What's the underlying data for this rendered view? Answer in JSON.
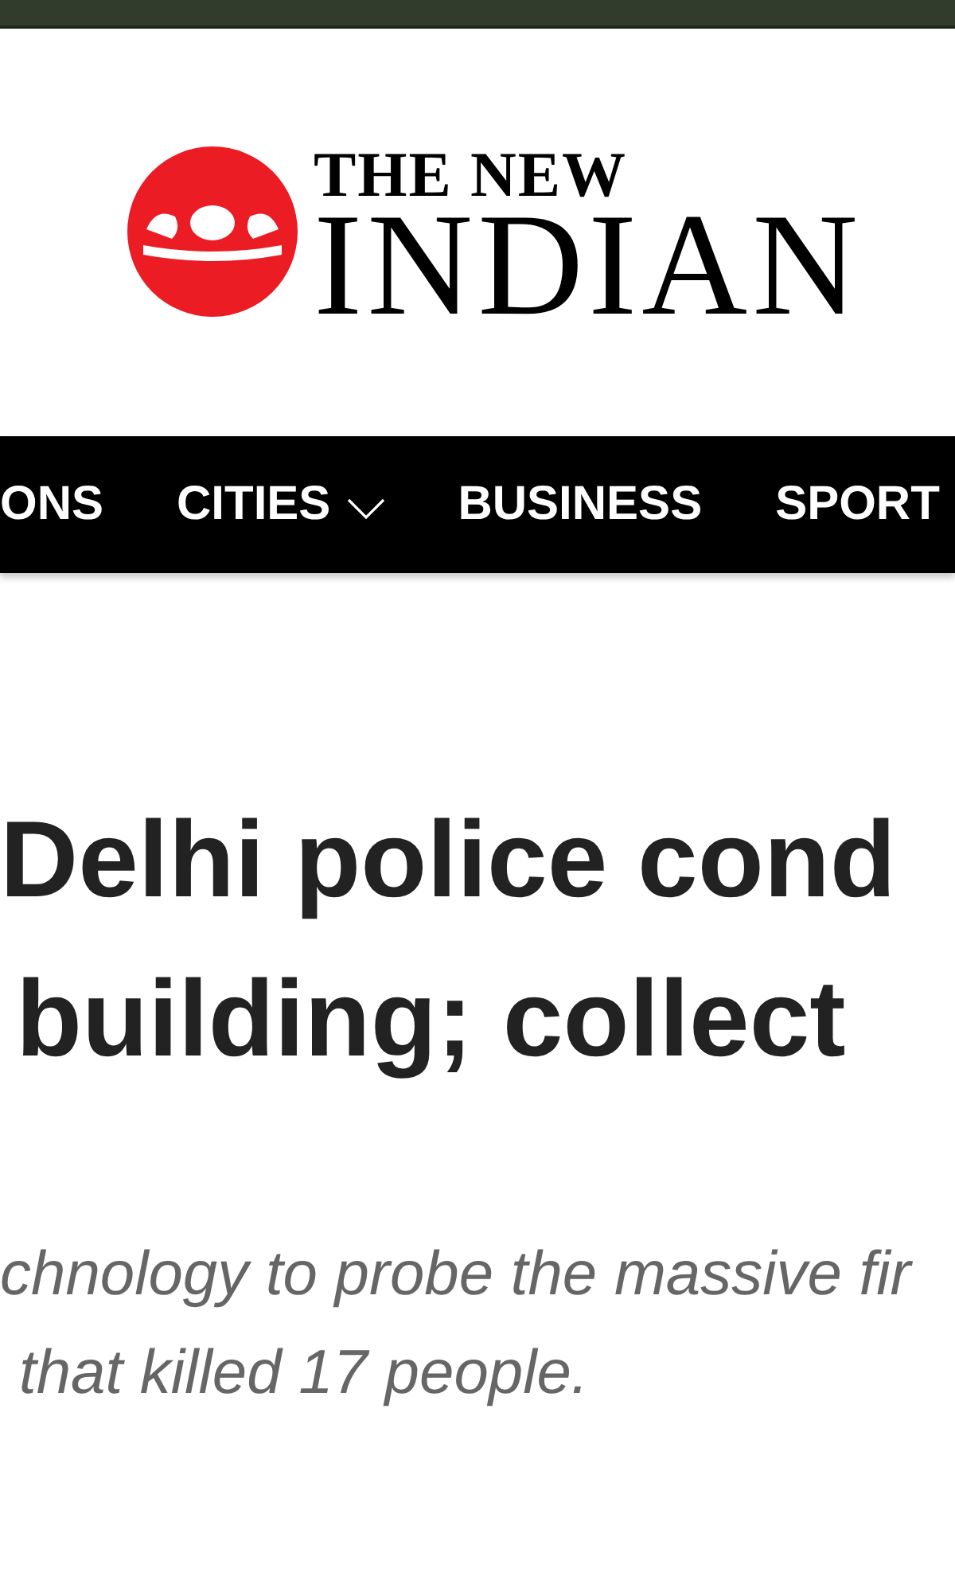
{
  "logo": {
    "line_1": "THE NEW",
    "line_2": "INDIAN"
  },
  "nav": [
    {
      "label": "ONS",
      "has_menu": false
    },
    {
      "label": "CITIES",
      "has_menu": true
    },
    {
      "label": "BUSINESS",
      "has_menu": false
    },
    {
      "label": "SPORT",
      "has_menu": false
    }
  ],
  "headline": [
    "Delhi police cond",
    "building; collect"
  ],
  "subtitle": [
    "chnology to probe the massive fir",
    "that killed 17 people."
  ]
}
